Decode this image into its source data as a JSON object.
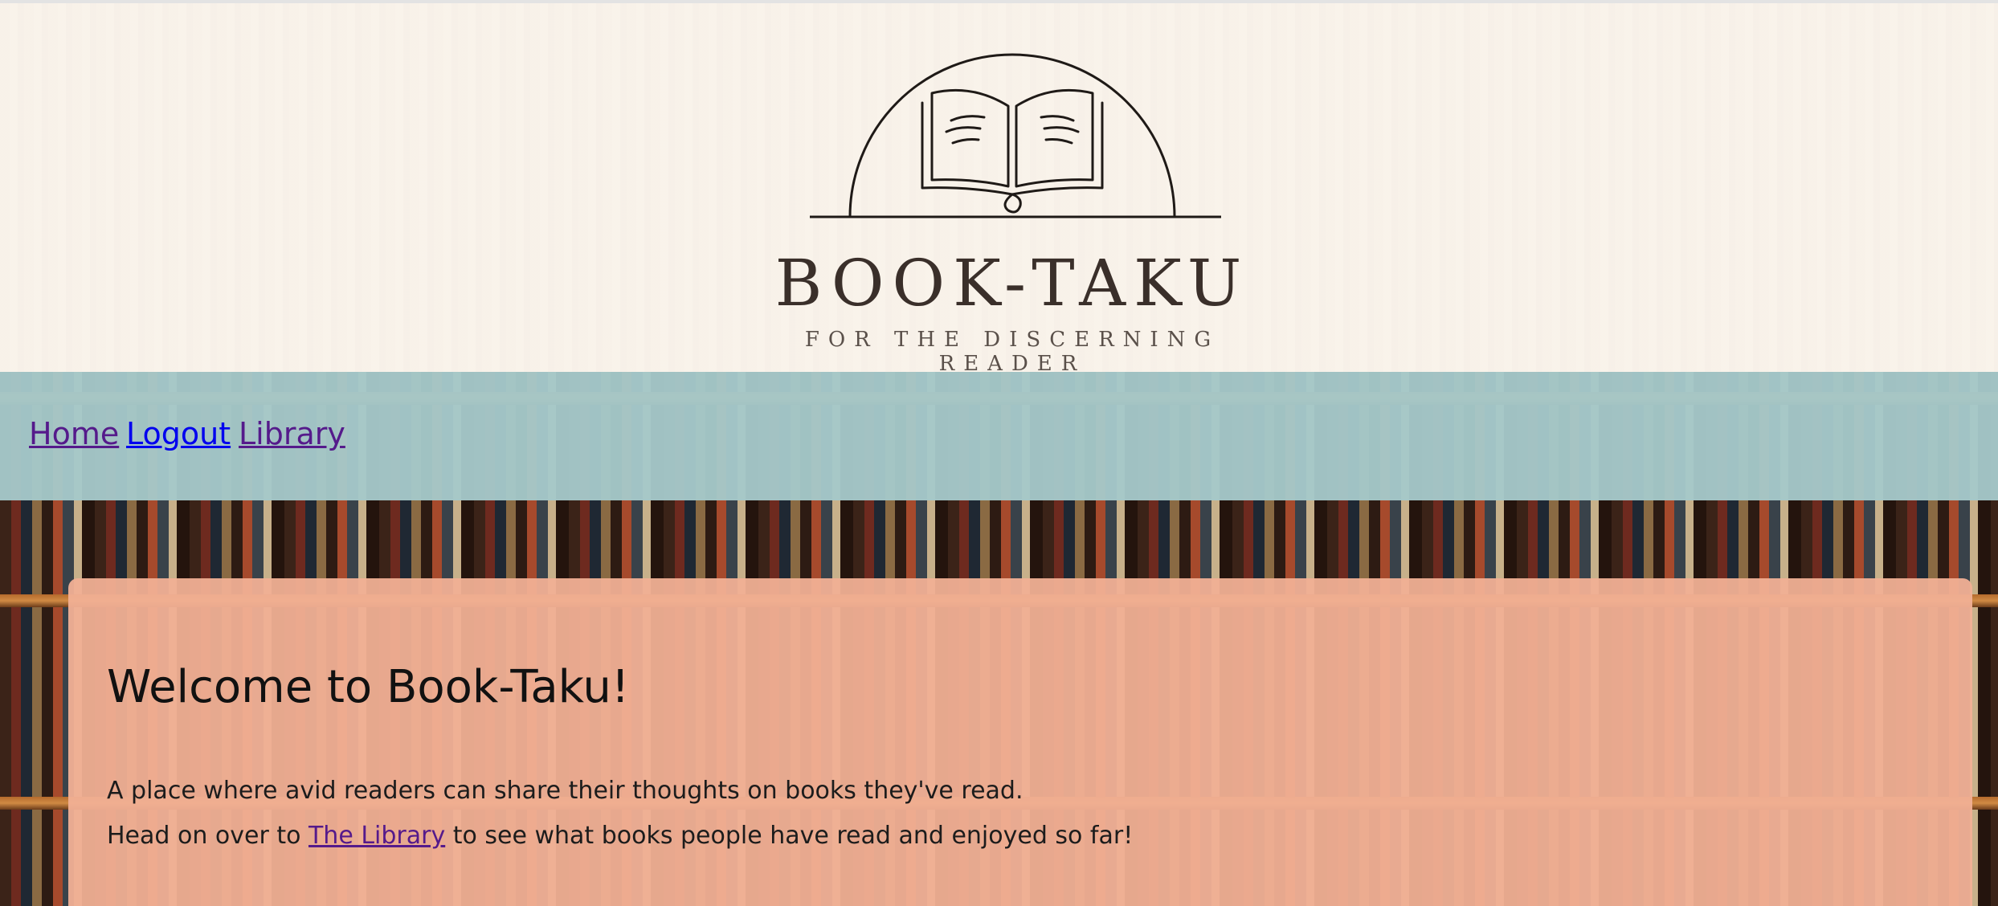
{
  "logo": {
    "title": "BOOK-TAKU",
    "tagline": "FOR THE DISCERNING READER",
    "icon": "open-book-icon"
  },
  "nav": {
    "links": [
      "Home",
      "Logout",
      "Library"
    ]
  },
  "main": {
    "heading": "Welcome to Book-Taku!",
    "paragraph1": "A place where avid readers can share their thoughts on books they've read.",
    "paragraph2_before": "Head on over to ",
    "paragraph2_link": "The Library",
    "paragraph2_after": " to see what books people have read and enjoyed so far!"
  },
  "colors": {
    "nav_background": "#a6c9ca",
    "card_background": "#f1b095",
    "visited_link": "#551a8b",
    "link": "#0000ee"
  }
}
